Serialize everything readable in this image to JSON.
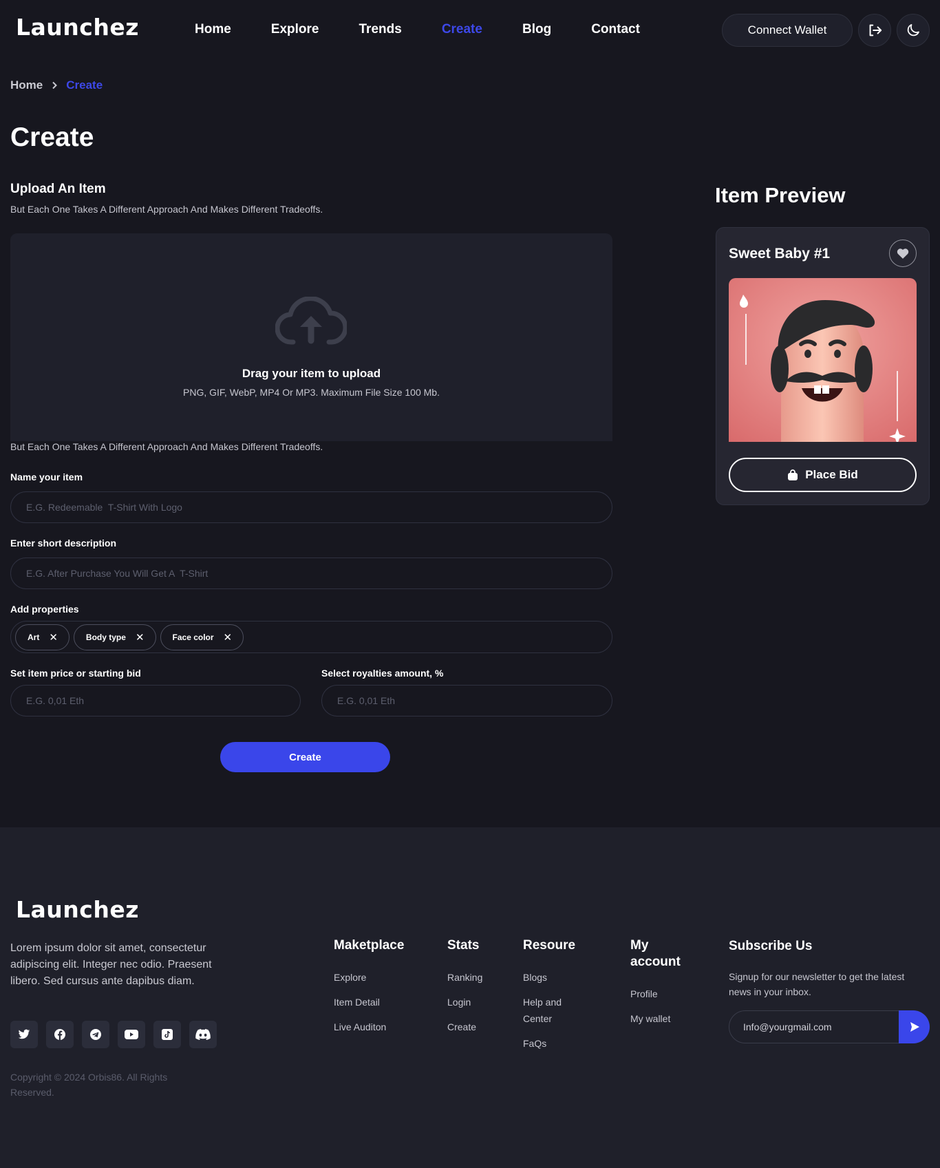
{
  "header": {
    "logo": "Launchez",
    "nav": [
      {
        "label": "Home"
      },
      {
        "label": "Explore"
      },
      {
        "label": "Trends"
      },
      {
        "label": "Create"
      },
      {
        "label": "Blog"
      },
      {
        "label": "Contact"
      }
    ],
    "active_nav": "Create",
    "connect_wallet": "Connect Wallet",
    "icons": [
      "logout-icon",
      "moon-icon"
    ]
  },
  "breadcrumb": {
    "home": "Home",
    "current": "Create"
  },
  "page_title": "Create",
  "upload_section": {
    "title": "Upload An Item",
    "subtitle": "But Each One Takes A Different Approach And Makes Different Tradeoffs.",
    "drop_title": "Drag your item to upload",
    "drop_hint": "PNG, GIF, WebP, MP4 Or MP3. Maximum File Size 100 Mb.",
    "note": "But Each One Takes A Different Approach And Makes Different Tradeoffs."
  },
  "form": {
    "name_label": "Name your item",
    "name_placeholder": "E.G. Redeemable  T-Shirt With Logo",
    "desc_label": "Enter short description",
    "desc_placeholder": "E.G. After Purchase You Will Get A  T-Shirt",
    "props_label": "Add properties",
    "properties": [
      "Art",
      "Body type",
      "Face color"
    ],
    "price_label": "Set item price or starting bid",
    "price_placeholder": "E.G. 0,01 Eth",
    "royalty_label": "Select royalties amount, %",
    "royalty_placeholder": "E.G. 0,01 Eth",
    "submit": "Create"
  },
  "preview": {
    "title": "Item Preview",
    "item_name": "Sweet Baby #1",
    "bid_button": "Place Bid"
  },
  "colors": {
    "accent": "#3d48e8",
    "background": "#17171f",
    "surface": "#1f202b"
  },
  "footer": {
    "logo": "Launchez",
    "about": "Lorem ipsum dolor sit amet, consectetur adipiscing elit. Integer nec odio. Praesent libero. Sed cursus ante dapibus diam.",
    "socials": [
      "twitter-icon",
      "facebook-icon",
      "telegram-icon",
      "youtube-icon",
      "tiktok-icon",
      "discord-icon"
    ],
    "copyright": "Copyright © 2024 Orbis86. All Rights Reserved.",
    "columns": [
      {
        "title": "Maketplace",
        "links": [
          "Explore",
          "Item Detail",
          "Live Auditon"
        ]
      },
      {
        "title": "Stats",
        "links": [
          "Ranking",
          "Login",
          "Create"
        ]
      },
      {
        "title": "Resoure",
        "links": [
          "Blogs",
          "Help and Center",
          "FaQs"
        ]
      },
      {
        "title": "My account",
        "links": [
          "Profile",
          "My wallet"
        ]
      }
    ],
    "subscribe": {
      "title": "Subscribe Us",
      "text": "Signup for our newsletter to get the latest news in your inbox.",
      "email": "Info@yourgmail.com"
    }
  }
}
